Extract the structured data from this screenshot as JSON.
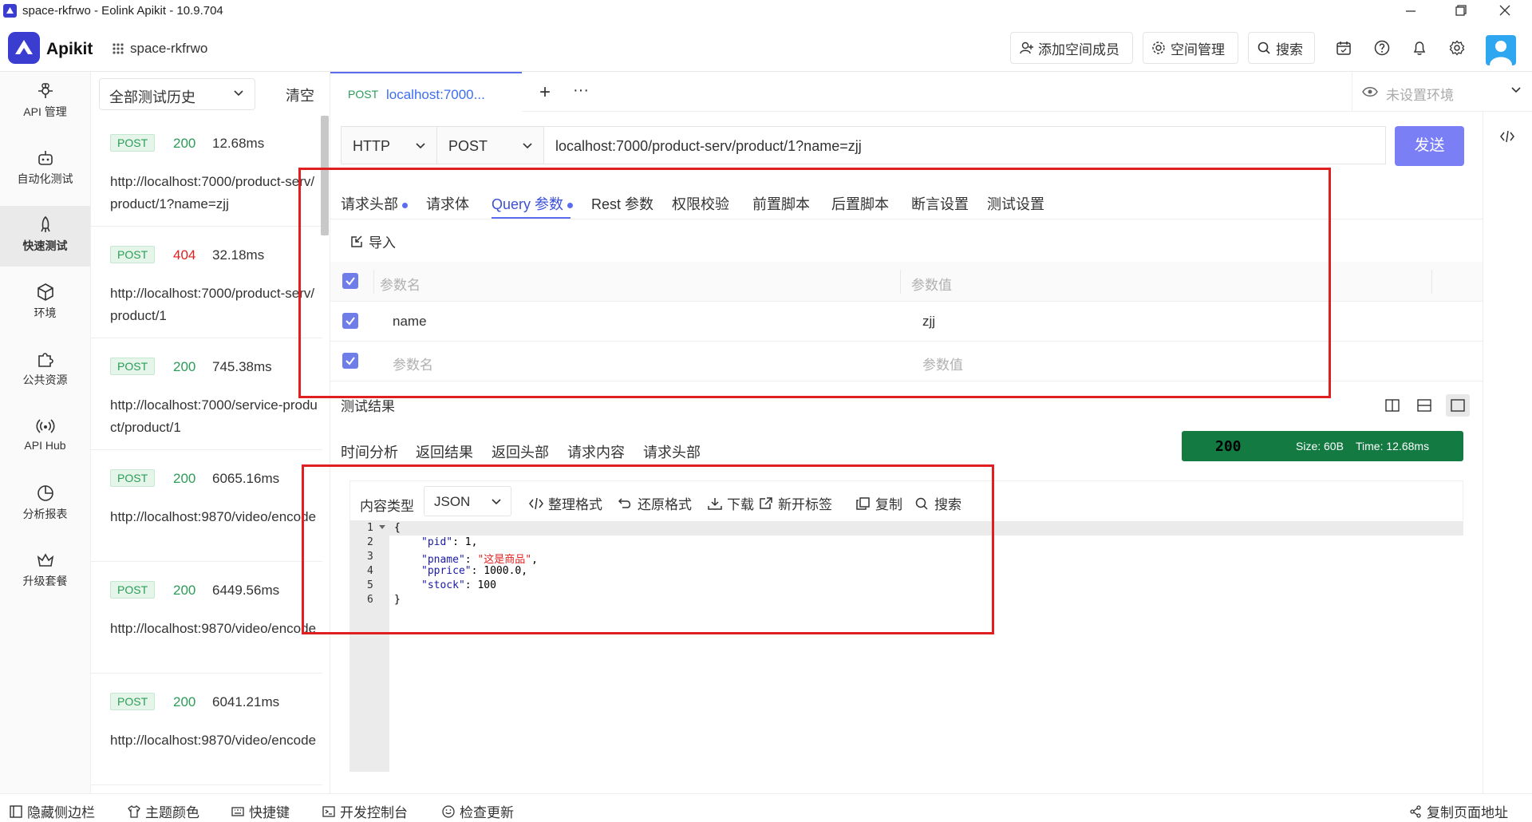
{
  "window": {
    "title": "space-rkfrwo - Eolink Apikit - 10.9.704"
  },
  "header": {
    "logo": "Apikit",
    "workspace": "space-rkfrwo",
    "add_member": "添加空间成员",
    "space_manage": "空间管理",
    "search": "搜索"
  },
  "nav": [
    {
      "label": "API 管理",
      "icon": "api-icon"
    },
    {
      "label": "自动化测试",
      "icon": "robot-icon"
    },
    {
      "label": "快速测试",
      "icon": "rocket-icon"
    },
    {
      "label": "环境",
      "icon": "cube-icon"
    },
    {
      "label": "公共资源",
      "icon": "puzzle-icon"
    },
    {
      "label": "API Hub",
      "icon": "hub-icon"
    },
    {
      "label": "分析报表",
      "icon": "pie-icon"
    },
    {
      "label": "升级套餐",
      "icon": "crown-icon"
    }
  ],
  "history": {
    "filter": "全部测试历史",
    "clear": "清空",
    "items": [
      {
        "method": "POST",
        "status": "200",
        "time": "12.68ms",
        "url": "http://localhost:7000/product-serv/product/1?name=zjj"
      },
      {
        "method": "POST",
        "status": "404",
        "time": "32.18ms",
        "url": "http://localhost:7000/product-serv/product/1"
      },
      {
        "method": "POST",
        "status": "200",
        "time": "745.38ms",
        "url": "http://localhost:7000/service-product/product/1"
      },
      {
        "method": "POST",
        "status": "200",
        "time": "6065.16ms",
        "url": "http://localhost:9870/video/encode"
      },
      {
        "method": "POST",
        "status": "200",
        "time": "6449.56ms",
        "url": "http://localhost:9870/video/encode"
      },
      {
        "method": "POST",
        "status": "200",
        "time": "6041.21ms",
        "url": "http://localhost:9870/video/encode"
      }
    ]
  },
  "tab": {
    "method": "POST",
    "title": "localhost:7000...",
    "plus": "+",
    "more": "···"
  },
  "env": {
    "label": "未设置环境"
  },
  "request": {
    "protocol": "HTTP",
    "method": "POST",
    "url": "localhost:7000/product-serv/product/1?name=zjj",
    "send": "发送"
  },
  "param_tabs": [
    "请求头部",
    "请求体",
    "Query 参数",
    "Rest 参数",
    "权限校验",
    "前置脚本",
    "后置脚本",
    "断言设置",
    "测试设置"
  ],
  "import": "导入",
  "params": {
    "col_name": "参数名",
    "col_value": "参数值",
    "rows": [
      {
        "name": "name",
        "value": "zjj"
      }
    ],
    "name_placeholder": "参数名",
    "value_placeholder": "参数值"
  },
  "result": {
    "title": "测试结果",
    "tabs": [
      "时间分析",
      "返回结果",
      "返回头部",
      "请求内容",
      "请求头部"
    ],
    "status": "200",
    "size": "Size:  60B",
    "time": "Time:  12.68ms",
    "content_type_label": "内容类型",
    "content_type": "JSON",
    "tools": [
      "整理格式",
      "还原格式",
      "下载",
      "新开标签",
      "复制",
      "搜索"
    ],
    "lines": [
      "1",
      "2",
      "3",
      "4",
      "5",
      "6"
    ],
    "json": {
      "pid_key": "\"pid\"",
      "pid_val": "1",
      "pname_key": "\"pname\"",
      "pname_val": "\"这是商品\"",
      "pprice_key": "\"pprice\"",
      "pprice_val": "1000.0",
      "stock_key": "\"stock\"",
      "stock_val": "100"
    }
  },
  "bottom": {
    "hide_sidebar": "隐藏侧边栏",
    "theme": "主题颜色",
    "shortcut": "快捷键",
    "devtools": "开发控制台",
    "update": "检查更新",
    "copy_url": "复制页面地址"
  },
  "colors": {
    "accent": "#5b6cf0",
    "success": "#137a42",
    "annotation": "#e02020"
  }
}
